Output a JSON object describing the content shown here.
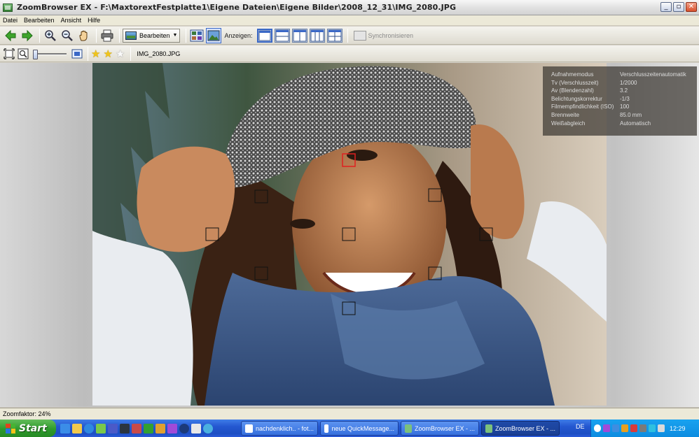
{
  "window": {
    "title": "ZoomBrowser EX - F:\\MaxtorextFestplatte1\\Eigene Dateien\\Eigene Bilder\\2008_12_31\\IMG_2080.JPG",
    "buttons": {
      "minimize": "_",
      "maximize": "▫",
      "close": "✕"
    }
  },
  "menu": [
    "Datei",
    "Bearbeiten",
    "Ansicht",
    "Hilfe"
  ],
  "toolbar": {
    "bearbeiten_label": "Bearbeiten",
    "anzeigen_label": "Anzeigen:",
    "sync_label": "Synchronisieren"
  },
  "toolbar2": {
    "rating": [
      true,
      true,
      false
    ],
    "filename": "IMG_2080.JPG"
  },
  "exif": {
    "rows": [
      {
        "key": "Aufnahmemodus",
        "value": "Verschlusszeitenautomatik"
      },
      {
        "key": "Tv (Verschlusszeit)",
        "value": "1/2000"
      },
      {
        "key": "Av (Blendenzahl)",
        "value": "3.2"
      },
      {
        "key": "Belichtungskorrektur",
        "value": "-1/3"
      },
      {
        "key": "Filmempfindlichkeit (ISO)",
        "value": "100"
      },
      {
        "key": "Brennweite",
        "value": "85.0 mm"
      },
      {
        "key": "Weißabgleich",
        "value": "Automatisch"
      }
    ]
  },
  "status": {
    "zoom_text": "Zoomfaktor: 24%"
  },
  "taskbar": {
    "start_label": "Start",
    "tasks": [
      {
        "label": "nachdenklich.. - fot...",
        "active": false
      },
      {
        "label": "neue QuickMessage...",
        "active": false
      },
      {
        "label": "ZoomBrowser EX - ...",
        "active": false
      },
      {
        "label": "ZoomBrowser EX - ...",
        "active": true
      }
    ],
    "language": "DE",
    "clock": "12:29"
  }
}
